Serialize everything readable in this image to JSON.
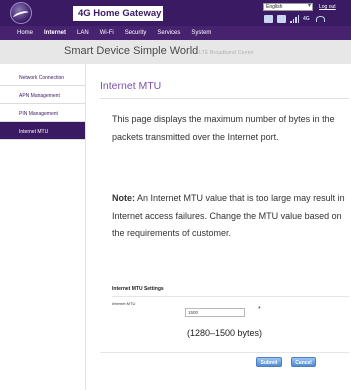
{
  "header": {
    "title": "4G Home Gateway",
    "language": "English",
    "logout": "Log out",
    "status_icons": [
      "sim-icon",
      "message-icon",
      "signal-bars-icon",
      "network-type-icon",
      "wifi-icon"
    ],
    "network_type": "4G"
  },
  "nav": {
    "tabs": [
      "Home",
      "Internet",
      "LAN",
      "Wi-Fi",
      "Security",
      "Services",
      "System"
    ],
    "active": "Internet"
  },
  "banner": {
    "slogan": "Smart Device  Simple World",
    "subtitle": "LTE Broadband Center"
  },
  "sidebar": {
    "items": [
      "Network Connection",
      "APN Management",
      "PIN Management",
      "Internet MTU"
    ],
    "active": "Internet MTU"
  },
  "main": {
    "page_title": "Internet MTU",
    "description": "This page displays the maximum number of bytes in the packets transmitted over the Internet port.",
    "note_label": "Note:",
    "note_text": " An Internet MTU value that is too large may result in Internet access failures. Change the MTU value based on the requirements of customer.",
    "section_title": "Internet MTU Settings",
    "field_label": "Internet MTU",
    "mtu_value": "1500",
    "required_mark": "*",
    "range_hint": "(1280–1500 bytes)",
    "submit_label": "Submit",
    "cancel_label": "Cancel"
  },
  "colors": {
    "brand_purple": "#3a1b63",
    "nav_purple": "#46226f",
    "title_purple": "#7a4fb0",
    "button_blue": "#4f8bd3"
  }
}
